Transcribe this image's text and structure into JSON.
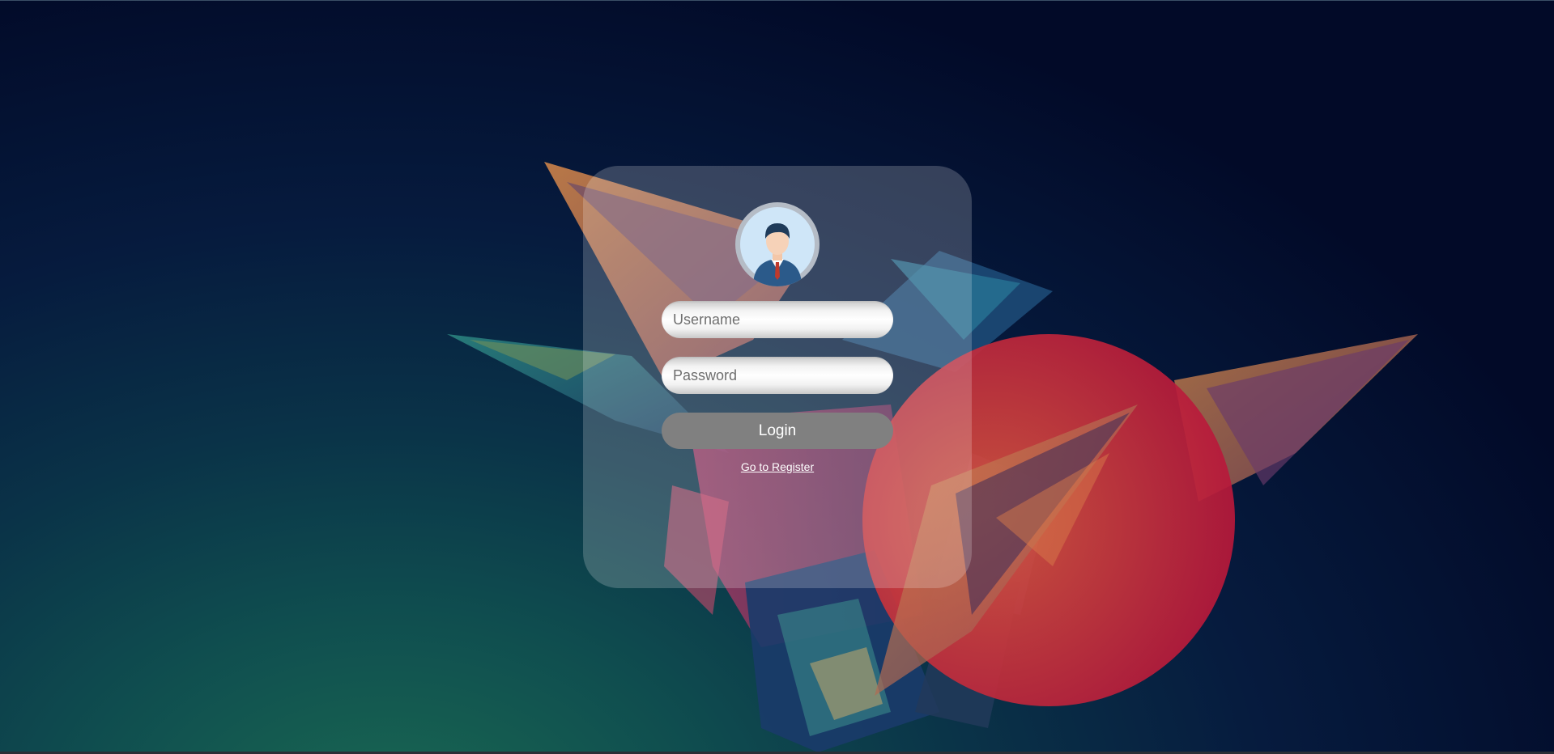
{
  "login": {
    "username_placeholder": "Username",
    "password_placeholder": "Password",
    "login_label": "Login",
    "register_label": "Go to Register"
  },
  "avatar": {
    "icon": "user-avatar-icon"
  },
  "colors": {
    "card_background": "rgba(255,255,255,0.2)",
    "button_background": "#808080",
    "button_text": "#ffffff",
    "link_text": "#ffffff",
    "sun_accent": "#c8102e"
  }
}
